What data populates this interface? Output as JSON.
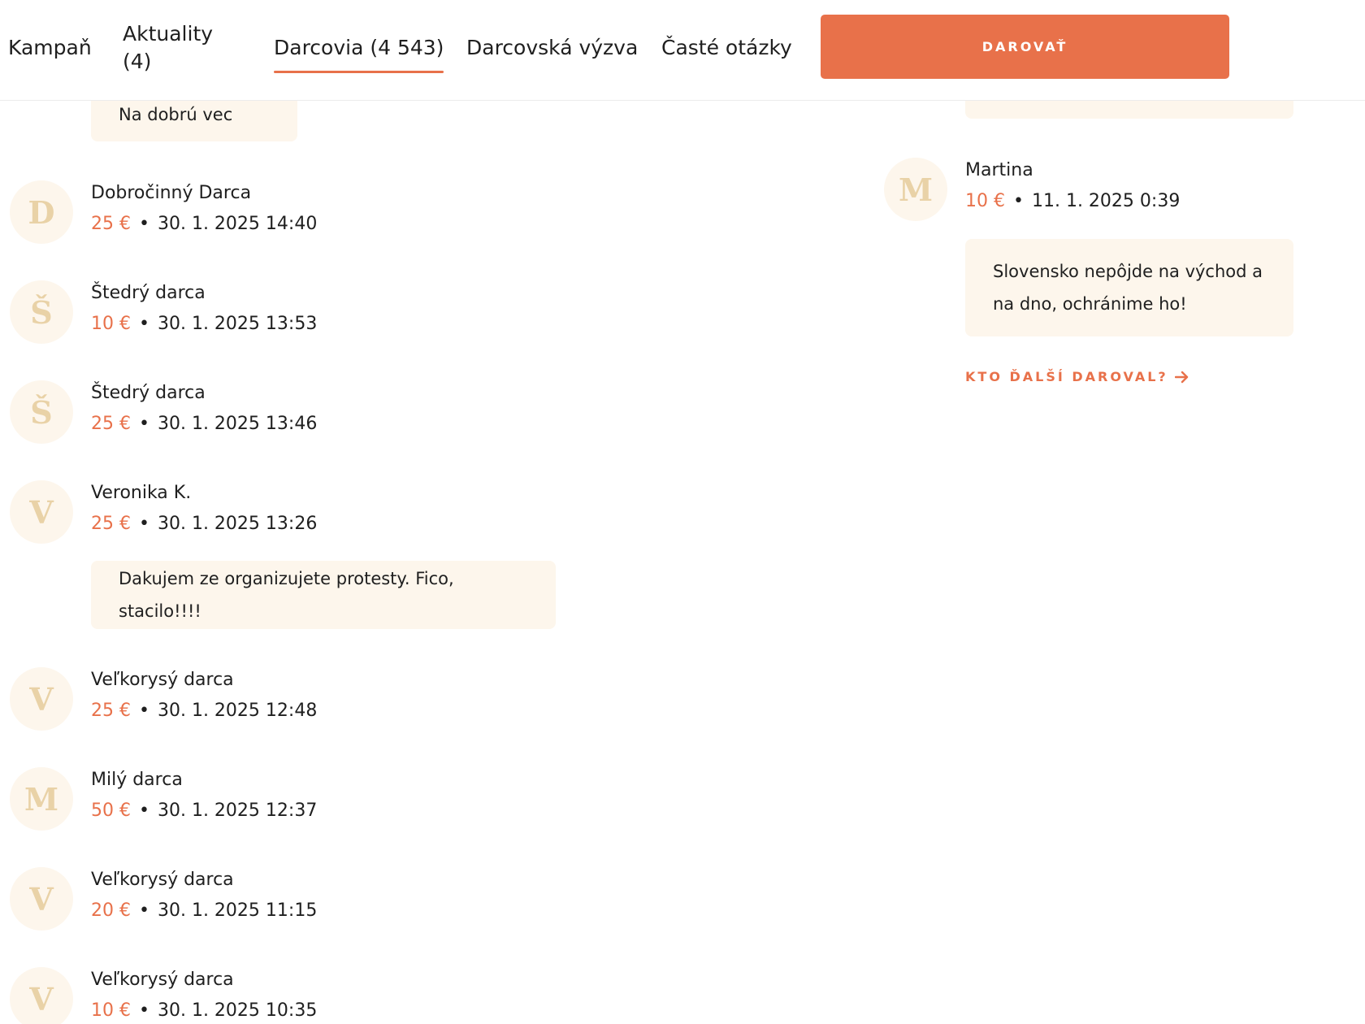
{
  "nav": {
    "tabs": [
      {
        "label": "Kampaň"
      },
      {
        "label": "Aktuality (4)"
      },
      {
        "label": "Darcovia (4 543)"
      },
      {
        "label": "Darcovská výzva"
      },
      {
        "label": "Časté otázky"
      }
    ],
    "donate_label": "DAROVAŤ"
  },
  "colors": {
    "accent": "#e8714a",
    "bubble": "#fdf6ec",
    "avatar_letter": "#e9d2a7"
  },
  "left_column": {
    "top_message": "Na dobrú vec",
    "donors": [
      {
        "initial": "D",
        "name": "Dobročinný Darca",
        "amount": "25 €",
        "date": "30. 1. 2025 14:40"
      },
      {
        "initial": "Š",
        "name": "Štedrý darca",
        "amount": "10 €",
        "date": "30. 1. 2025 13:53"
      },
      {
        "initial": "Š",
        "name": "Štedrý darca",
        "amount": "25 €",
        "date": "30. 1. 2025 13:46"
      },
      {
        "initial": "V",
        "name": "Veronika K.",
        "amount": "25 €",
        "date": "30. 1. 2025 13:26",
        "message": "Dakujem ze organizujete protesty. Fico, stacilo!!!!"
      },
      {
        "initial": "V",
        "name": "Veľkorysý darca",
        "amount": "25 €",
        "date": "30. 1. 2025 12:48"
      },
      {
        "initial": "M",
        "name": "Milý darca",
        "amount": "50 €",
        "date": "30. 1. 2025 12:37"
      },
      {
        "initial": "V",
        "name": "Veľkorysý darca",
        "amount": "20 €",
        "date": "30. 1. 2025 11:15"
      },
      {
        "initial": "V",
        "name": "Veľkorysý darca",
        "amount": "10 €",
        "date": "30. 1. 2025 10:35"
      }
    ]
  },
  "right_column": {
    "donor": {
      "initial": "M",
      "name": "Martina",
      "amount": "10 €",
      "date": "11. 1. 2025 0:39"
    },
    "message_line1": "Slovensko nepôjde na východ a",
    "message_line2": "na dno, ochránime ho!",
    "more_link": "KTO ĎALŠÍ DAROVAL?"
  },
  "separator": "•"
}
